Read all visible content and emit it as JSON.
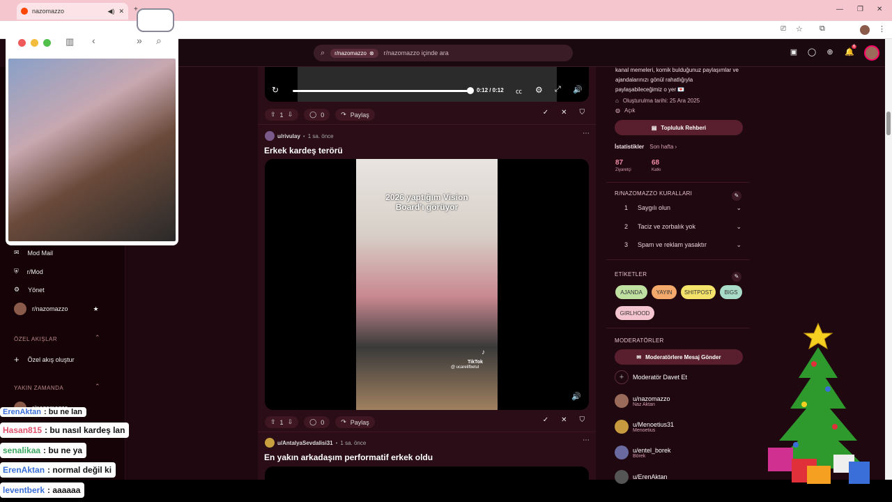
{
  "browser": {
    "tab_title": "nazomazzo"
  },
  "topbar": {
    "search_chip": "r/nazomazzo",
    "search_placeholder": "r/nazomazzo içinde ara",
    "notif_count": "6"
  },
  "sidebar": {
    "items": [
      {
        "label": "Mod Mail"
      },
      {
        "label": "r/Mod"
      },
      {
        "label": "Yönet"
      },
      {
        "label": "r/nazomazzo"
      }
    ],
    "section_custom": "ÖZEL AKIŞLAR",
    "create_feed": "Özel akış oluştur",
    "section_recent": "YAKIN ZAMANDA",
    "recent_item": "r/nazomazzo"
  },
  "feed": {
    "video_time": "0:12 / 0:12",
    "post1": {
      "votes": "1",
      "comments": "0",
      "share": "Paylaş"
    },
    "post2": {
      "author": "u/rivulay",
      "time": "1 sa. önce",
      "title": "Erkek kardeş terörü",
      "overlay_text": "2026 yaptığım Vision Board'ı görüyor",
      "tiktok_brand": "TikTok",
      "tiktok_user": "@ ucarelifbetul",
      "votes": "1",
      "comments": "0",
      "share": "Paylaş"
    },
    "post3": {
      "author": "u/AntalyaSevdalisi31",
      "time": "1 sa. önce",
      "title": "En yakın arkadaşım performatif erkek oldu"
    }
  },
  "rightbar": {
    "description": "kanal memeleri, komik bulduğunuz paylaşımlar ve ajandalarınızı gönül rahatlığıyla paylaşabileceğimiz o yer 💌",
    "created": "Oluşturulma tarihi: 25 Ara 2025",
    "status": "Açık",
    "guide_button": "Topluluk Rehberi",
    "stats_label": "İstatistikler",
    "stats_period": "Son hafta",
    "visitors_value": "87",
    "visitors_label": "Ziyaretçi",
    "contrib_value": "68",
    "contrib_label": "Katkı",
    "rules_head": "R/NAZOMAZZO KURALLARI",
    "rules": [
      {
        "n": "1",
        "text": "Saygılı olun"
      },
      {
        "n": "2",
        "text": "Taciz ve zorbalık yok"
      },
      {
        "n": "3",
        "text": "Spam ve reklam yasaktır"
      }
    ],
    "tags_head": "ETİKETLER",
    "tags": [
      {
        "text": "AJANDA",
        "color": "#bfe0a0"
      },
      {
        "text": "YAYIN",
        "color": "#f3a96b"
      },
      {
        "text": "SHITPOST",
        "color": "#f3e36b"
      },
      {
        "text": "BIGS",
        "color": "#a8dcc8"
      },
      {
        "text": "GIRLHOOD",
        "color": "#f4c4d0"
      }
    ],
    "mods_head": "MODERATÖRLER",
    "mod_message_button": "Moderatörlere Mesaj Gönder",
    "invite_mod": "Moderatör Davet Et",
    "mods": [
      {
        "name": "u/nazomazzo",
        "sub": "Naz Aktan"
      },
      {
        "name": "u/Menoetius31",
        "sub": "Menoetius"
      },
      {
        "name": "u/entel_borek",
        "sub": "Börek"
      },
      {
        "name": "u/ErenAktan",
        "sub": ""
      }
    ]
  },
  "chat": [
    {
      "user": "ErenAktan",
      "msg": ": bu ne lan",
      "color": "#3a6ed8"
    },
    {
      "user": "Hasan815",
      "msg": ": bu nasıl kardeş lan",
      "color": "#e0506a"
    },
    {
      "user": "senalikaa",
      "msg": ": bu ne ya",
      "color": "#3aa860"
    },
    {
      "user": "ErenAktan",
      "msg": ": normal değil ki",
      "color": "#3a6ed8"
    },
    {
      "user": "leventberk",
      "msg": ": aaaaaa",
      "color": "#3a6ed8"
    }
  ]
}
